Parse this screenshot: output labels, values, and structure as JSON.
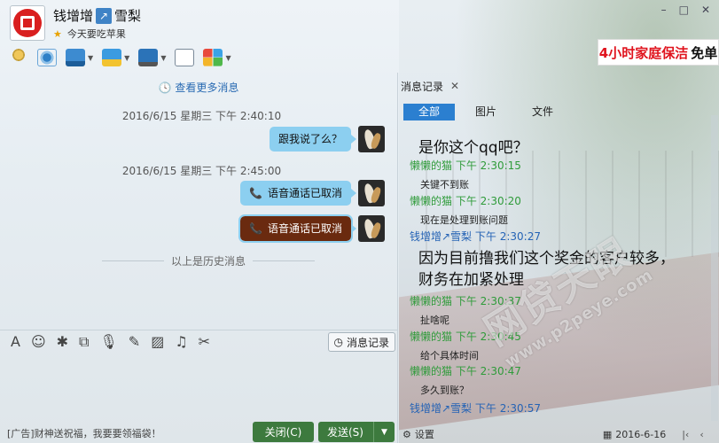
{
  "header": {
    "nickname_part1": "钱增增",
    "nickname_part2": "雪梨",
    "signature": "今天要吃苹果",
    "window_buttons": [
      "–",
      "□",
      "✕"
    ]
  },
  "ad_banner": {
    "text_red": "4小时家庭保洁",
    "text_black": "免单"
  },
  "chat": {
    "more_messages": "查看更多消息",
    "messages": [
      {
        "timestamp": "2016/6/15 星期三 下午 2:40:10",
        "text": "跟我说了么？"
      },
      {
        "timestamp": "2016/6/15 星期三 下午 2:45:00",
        "text": "语音通话已取消"
      },
      {
        "text": "语音通话已取消"
      }
    ],
    "history_separator": "以上是历史消息"
  },
  "input_toolbar": {
    "history_button": "消息记录"
  },
  "bottom": {
    "ad_text": "[广告]财神送祝福，我要要领福袋！",
    "close_button": "关闭(C)",
    "send_button": "发送(S)"
  },
  "history": {
    "tab_label": "消息记录",
    "filters": [
      "全部",
      "图片",
      "文件"
    ],
    "records": [
      {
        "body": "是你这个qq吧？",
        "big": true
      },
      {
        "sender": "懒懒的猫",
        "time": "下午 2:30:15",
        "body": "关键不到账"
      },
      {
        "sender": "懒懒的猫",
        "time": "下午 2:30:20",
        "body": "现在是处理到账问题"
      },
      {
        "sender": "钱增增↗雪梨",
        "time": "下午 2:30:27",
        "body": "因为目前撸我们这个奖金的客户较多，财务在加紧处理",
        "big": true
      },
      {
        "sender": "懒懒的猫",
        "time": "下午 2:30:37",
        "body": "扯啥呢"
      },
      {
        "sender": "懒懒的猫",
        "time": "下午 2:30:45",
        "body": "给个具体时间"
      },
      {
        "sender": "懒懒的猫",
        "time": "下午 2:30:47",
        "body": "多久到账？"
      },
      {
        "sender": "钱增增↗雪梨",
        "time": "下午 2:30:57",
        "body": ""
      }
    ],
    "settings_label": "设置",
    "date": "2016-6-16"
  },
  "watermark": {
    "main": "网贷天眼",
    "sub": "www.p2peye.com"
  },
  "colors": {
    "bubble": "#8ccff0",
    "green_sender": "#2f9b3a",
    "blue_sender": "#2563b5",
    "button_green": "#3d7a3e",
    "tab_blue": "#2b7fd0"
  }
}
